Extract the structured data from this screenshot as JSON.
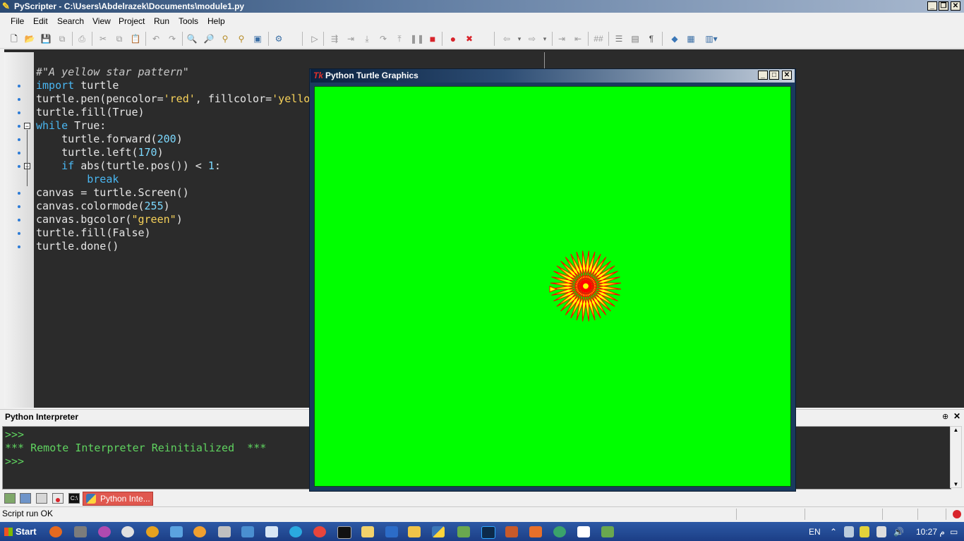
{
  "app": {
    "title": "PyScripter - C:\\Users\\Abdelrazek\\Documents\\module1.py"
  },
  "menu": [
    "File",
    "Edit",
    "Search",
    "View",
    "Project",
    "Run",
    "Tools",
    "Help"
  ],
  "editor": {
    "lines": [
      {
        "parts": [
          {
            "t": "#\"A yellow star pattern\"",
            "c": "cm"
          }
        ]
      },
      {
        "parts": [
          {
            "t": "import",
            "c": "kw"
          },
          {
            "t": " turtle",
            "c": ""
          }
        ]
      },
      {
        "parts": [
          {
            "t": "turtle.pen(pencolor=",
            "c": ""
          },
          {
            "t": "'red'",
            "c": "st"
          },
          {
            "t": ", fillcolor=",
            "c": ""
          },
          {
            "t": "'yello",
            "c": "st"
          }
        ]
      },
      {
        "parts": [
          {
            "t": "turtle.fill(True)",
            "c": ""
          }
        ]
      },
      {
        "parts": [
          {
            "t": "while",
            "c": "kw"
          },
          {
            "t": " True:",
            "c": ""
          }
        ]
      },
      {
        "parts": [
          {
            "t": "    turtle.forward(",
            "c": ""
          },
          {
            "t": "200",
            "c": "nm"
          },
          {
            "t": ")",
            "c": ""
          }
        ]
      },
      {
        "parts": [
          {
            "t": "    turtle.left(",
            "c": ""
          },
          {
            "t": "170",
            "c": "nm"
          },
          {
            "t": ")",
            "c": ""
          }
        ]
      },
      {
        "parts": [
          {
            "t": "    ",
            "c": ""
          },
          {
            "t": "if",
            "c": "kw"
          },
          {
            "t": " abs(turtle.pos()) < ",
            "c": ""
          },
          {
            "t": "1",
            "c": "nm"
          },
          {
            "t": ":",
            "c": ""
          }
        ]
      },
      {
        "parts": [
          {
            "t": "        ",
            "c": ""
          },
          {
            "t": "break",
            "c": "kw"
          }
        ]
      },
      {
        "parts": [
          {
            "t": "canvas = turtle.Screen()",
            "c": ""
          }
        ]
      },
      {
        "parts": [
          {
            "t": "canvas.colormode(",
            "c": ""
          },
          {
            "t": "255",
            "c": "nm"
          },
          {
            "t": ")",
            "c": ""
          }
        ]
      },
      {
        "parts": [
          {
            "t": "canvas.bgcolor(",
            "c": ""
          },
          {
            "t": "\"green\"",
            "c": "st"
          },
          {
            "t": ")",
            "c": ""
          }
        ]
      },
      {
        "parts": [
          {
            "t": "turtle.fill(False)",
            "c": ""
          }
        ]
      },
      {
        "parts": [
          {
            "t": "turtle.done()",
            "c": ""
          }
        ]
      }
    ]
  },
  "interpreter": {
    "title": "Python Interpreter",
    "lines": [
      ">>>",
      "*** Remote Interpreter Reinitialized  ***",
      ">>>"
    ]
  },
  "tabs": {
    "active_label": "Python Inte..."
  },
  "status": {
    "text": "Script run OK"
  },
  "turtle_window": {
    "title": "Python Turtle Graphics",
    "bg_color": "#00ff00",
    "star": {
      "pen_color": "red",
      "fill_color": "yellow"
    }
  },
  "taskbar": {
    "start_label": "Start",
    "lang": "EN",
    "clock": "10:27 م"
  },
  "colors": {
    "editor_bg": "#2b2b2b",
    "keyword": "#4ab7f2",
    "prompt": "#5fd35f",
    "active_tab": "#e0584f"
  }
}
